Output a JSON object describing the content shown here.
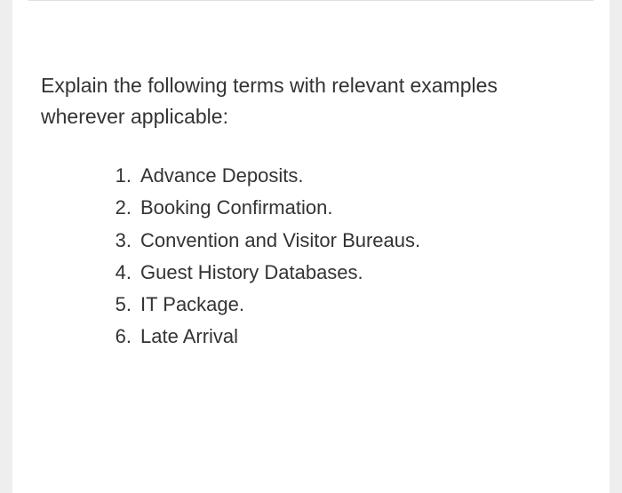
{
  "prompt": "Explain the following terms with relevant examples wherever applicable:",
  "items": [
    {
      "num": "1.",
      "text": "Advance Deposits."
    },
    {
      "num": "2.",
      "text": "Booking Confirmation."
    },
    {
      "num": "3.",
      "text": "Convention and Visitor Bureaus."
    },
    {
      "num": "4.",
      "text": "Guest History Databases."
    },
    {
      "num": "5.",
      "text": "IT Package."
    },
    {
      "num": "6.",
      "text": "Late Arrival"
    }
  ]
}
